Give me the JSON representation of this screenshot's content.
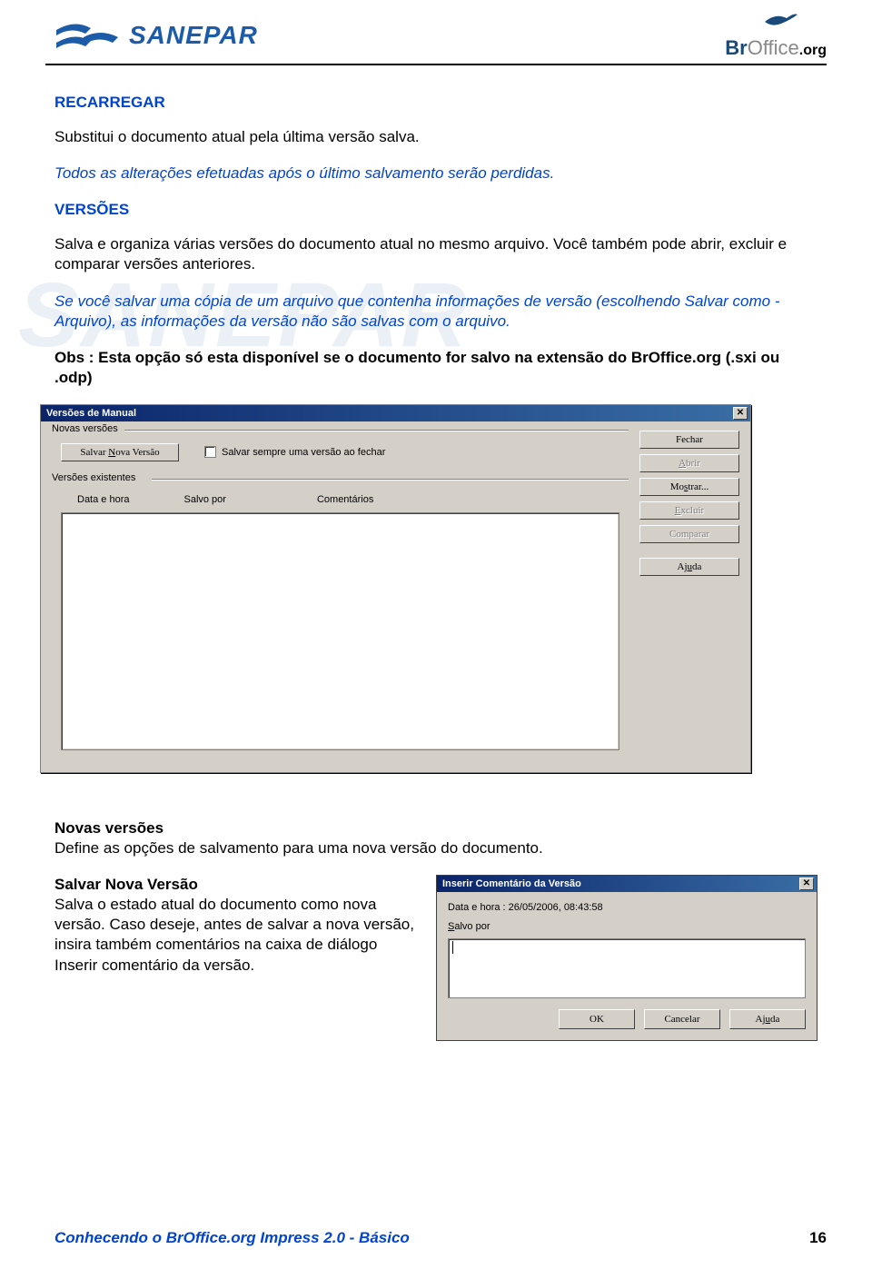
{
  "header": {
    "sanepar": "SANEPAR",
    "broffice_br": "Br",
    "broffice_office": "Office",
    "broffice_org": ".org"
  },
  "watermark": "SANEPAR",
  "sec1": {
    "heading": "RECARREGAR",
    "p1": "Substitui o documento atual pela última versão salva.",
    "p2": "Todos as alterações efetuadas após o último salvamento serão perdidas."
  },
  "sec2": {
    "heading": "VERSÕES",
    "p1": "Salva e organiza várias versões do documento atual no mesmo arquivo. Você também pode abrir, excluir e comparar versões anteriores.",
    "p2": "Se você salvar uma cópia de um arquivo que contenha informações de versão (escolhendo Salvar como - Arquivo), as informações da versão não são salvas com o arquivo.",
    "p3": "Obs : Esta opção só esta disponível se o documento for salvo na extensão do BrOffice.org (.sxi ou .odp)"
  },
  "dialog1": {
    "title": "Versões de Manual",
    "group1": "Novas versões",
    "save_btn": "Salvar Nova Versão",
    "chk_label": "Salvar sempre uma versão ao fechar",
    "group2": "Versões existentes",
    "col1": "Data e hora",
    "col2": "Salvo por",
    "col3": "Comentários",
    "btn_close": "Fechar",
    "btn_open": "Abrir",
    "btn_show": "Mostrar...",
    "btn_delete": "Excluir",
    "btn_compare": "Comparar",
    "btn_help": "Ajuda"
  },
  "sec3": {
    "h1": "Novas versões",
    "p1": "Define as opções de salvamento para uma nova versão do documento.",
    "h2": "Salvar Nova Versão",
    "p2": "Salva o estado atual do documento como nova versão. Caso deseje, antes de salvar a nova versão, insira também comentários na caixa de diálogo Inserir comentário da versão."
  },
  "dialog2": {
    "title": "Inserir Comentário da Versão",
    "line1": "Data e hora : 26/05/2006, 08:43:58",
    "line2": "Salvo por",
    "btn_ok": "OK",
    "btn_cancel": "Cancelar",
    "btn_help": "Ajuda"
  },
  "footer": {
    "title": "Conhecendo o BrOffice.org Impress  2.0 -  Básico",
    "page": "16"
  }
}
